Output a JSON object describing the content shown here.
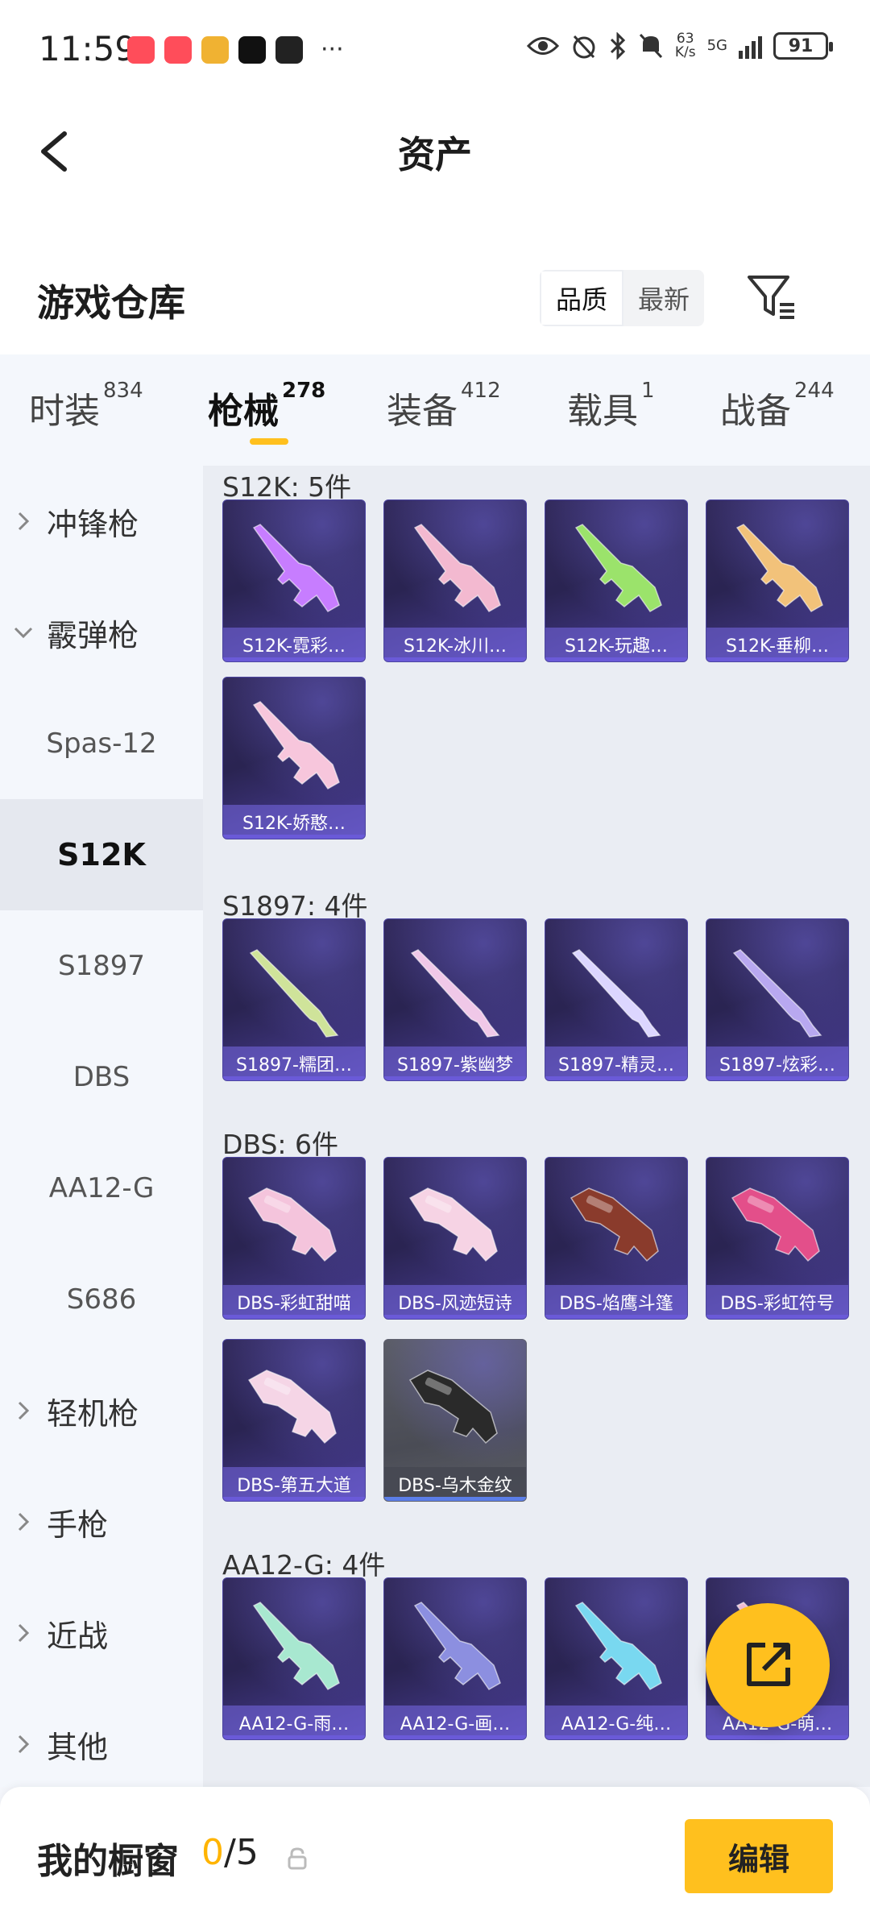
{
  "status_bar": {
    "time": "11:59",
    "more": "···",
    "net_speed_value": "63",
    "net_speed_unit": "K/s",
    "network": "5G",
    "battery": "91",
    "icons": [
      "eye-icon",
      "alarm-icon",
      "bluetooth-icon",
      "mute-icon"
    ]
  },
  "nav": {
    "title": "资产",
    "back_icon": "chevron-left-icon"
  },
  "section": {
    "title": "游戏仓库",
    "sort_options": [
      "品质",
      "最新"
    ],
    "sort_selected": "品质",
    "filter_icon": "filter-icon"
  },
  "tabs": [
    {
      "label": "时装",
      "count": "834"
    },
    {
      "label": "枪械",
      "count": "278"
    },
    {
      "label": "装备",
      "count": "412"
    },
    {
      "label": "载具",
      "count": "1"
    },
    {
      "label": "战备",
      "count": "244"
    }
  ],
  "active_tab": "枪械",
  "categories": [
    {
      "label": "冲锋枪",
      "type": "group",
      "expanded": false
    },
    {
      "label": "霰弹枪",
      "type": "group",
      "expanded": true
    },
    {
      "label": "Spas-12",
      "type": "sub"
    },
    {
      "label": "S12K",
      "type": "sub",
      "selected": true
    },
    {
      "label": "S1897",
      "type": "sub"
    },
    {
      "label": "DBS",
      "type": "sub"
    },
    {
      "label": "AA12-G",
      "type": "sub"
    },
    {
      "label": "S686",
      "type": "sub"
    },
    {
      "label": "轻机枪",
      "type": "group",
      "expanded": false
    },
    {
      "label": "手枪",
      "type": "group",
      "expanded": false
    },
    {
      "label": "近战",
      "type": "group",
      "expanded": false
    },
    {
      "label": "其他",
      "type": "group",
      "expanded": false
    }
  ],
  "groups": [
    {
      "title": "S12K: 5件",
      "items": [
        "S12K-霓彩…",
        "S12K-冰川…",
        "S12K-玩趣…",
        "S12K-垂柳…",
        "S12K-娇憨…"
      ]
    },
    {
      "title": "S1897: 4件",
      "items": [
        "S1897-糯团…",
        "S1897-紫幽梦",
        "S1897-精灵…",
        "S1897-炫彩…"
      ]
    },
    {
      "title": "DBS: 6件",
      "items": [
        "DBS-彩虹甜喵",
        "DBS-风迹短诗",
        "DBS-焰鹰斗篷",
        "DBS-彩虹符号",
        "DBS-第五大道",
        "DBS-乌木金纹"
      ]
    },
    {
      "title": "AA12-G: 4件",
      "items": [
        "AA12-G-雨…",
        "AA12-G-画…",
        "AA12-G-纯…",
        "AA12-G-萌…"
      ]
    }
  ],
  "gun_colors": {
    "s12k": [
      "#c77dff",
      "#f3b9d0",
      "#9be36b",
      "#f2c27a",
      "#f7c6dc"
    ],
    "s1897": [
      "#cfe39a",
      "#f0c8e8",
      "#dcd6ff",
      "#b8a8f0"
    ],
    "dbs": [
      "#f4c4dc",
      "#f6d3e4",
      "#8a3b2c",
      "#e34f8a",
      "#f5d5e6",
      "#2a2a2a"
    ],
    "aa12": [
      "#a8e8d0",
      "#8c8fe0",
      "#79d8f0",
      "#f4c0d8"
    ]
  },
  "fab": {
    "icon": "share-external-icon"
  },
  "bottom_bar": {
    "title": "我的橱窗",
    "count_current": "0",
    "count_total": "/5",
    "lock_icon": "lock-icon",
    "edit_label": "编辑"
  }
}
